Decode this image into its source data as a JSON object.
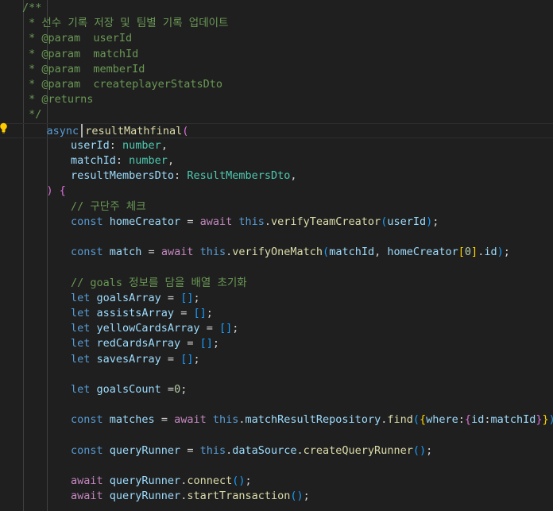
{
  "editor": {
    "lightbulb_icon": "lightbulb-icon",
    "cursor_line": 8,
    "lines": [
      {
        "indent": 0,
        "tokens": [
          {
            "t": "/**",
            "c": "comment"
          }
        ]
      },
      {
        "indent": 0,
        "tokens": [
          {
            "t": " * 선수 기록 저장 및 팀별 기록 업데이트",
            "c": "comment"
          }
        ]
      },
      {
        "indent": 0,
        "tokens": [
          {
            "t": " * @param  userId",
            "c": "comment"
          }
        ]
      },
      {
        "indent": 0,
        "tokens": [
          {
            "t": " * @param  matchId",
            "c": "comment"
          }
        ]
      },
      {
        "indent": 0,
        "tokens": [
          {
            "t": " * @param  memberId",
            "c": "comment"
          }
        ]
      },
      {
        "indent": 0,
        "tokens": [
          {
            "t": " * @param  createplayerStatsDto",
            "c": "comment"
          }
        ]
      },
      {
        "indent": 0,
        "tokens": [
          {
            "t": " * @returns",
            "c": "comment"
          }
        ]
      },
      {
        "indent": 0,
        "tokens": [
          {
            "t": " */",
            "c": "comment"
          }
        ]
      },
      {
        "indent": 1,
        "tokens": [
          {
            "t": "async ",
            "c": "keyword"
          },
          {
            "t": "resultMathfinal",
            "c": "func"
          },
          {
            "t": "(",
            "c": "bracket2"
          }
        ]
      },
      {
        "indent": 2,
        "tokens": [
          {
            "t": "userId",
            "c": "var"
          },
          {
            "t": ": ",
            "c": "plain"
          },
          {
            "t": "number",
            "c": "type"
          },
          {
            "t": ",",
            "c": "plain"
          }
        ]
      },
      {
        "indent": 2,
        "tokens": [
          {
            "t": "matchId",
            "c": "var"
          },
          {
            "t": ": ",
            "c": "plain"
          },
          {
            "t": "number",
            "c": "type"
          },
          {
            "t": ",",
            "c": "plain"
          }
        ]
      },
      {
        "indent": 2,
        "tokens": [
          {
            "t": "resultMembersDto",
            "c": "var"
          },
          {
            "t": ": ",
            "c": "plain"
          },
          {
            "t": "ResultMembersDto",
            "c": "type"
          },
          {
            "t": ",",
            "c": "plain"
          }
        ]
      },
      {
        "indent": 1,
        "tokens": [
          {
            "t": ")",
            "c": "bracket2"
          },
          {
            "t": " ",
            "c": "plain"
          },
          {
            "t": "{",
            "c": "bracket2"
          }
        ]
      },
      {
        "indent": 2,
        "tokens": [
          {
            "t": "// 구단주 체크",
            "c": "comment"
          }
        ]
      },
      {
        "indent": 2,
        "tokens": [
          {
            "t": "const ",
            "c": "keyword"
          },
          {
            "t": "homeCreator",
            "c": "var"
          },
          {
            "t": " = ",
            "c": "plain"
          },
          {
            "t": "await ",
            "c": "keyword-flow"
          },
          {
            "t": "this",
            "c": "keyword"
          },
          {
            "t": ".",
            "c": "plain"
          },
          {
            "t": "verifyTeamCreator",
            "c": "func"
          },
          {
            "t": "(",
            "c": "bracket3"
          },
          {
            "t": "userId",
            "c": "var"
          },
          {
            "t": ")",
            "c": "bracket3"
          },
          {
            "t": ";",
            "c": "plain"
          }
        ]
      },
      {
        "indent": 0,
        "tokens": []
      },
      {
        "indent": 2,
        "tokens": [
          {
            "t": "const ",
            "c": "keyword"
          },
          {
            "t": "match",
            "c": "var"
          },
          {
            "t": " = ",
            "c": "plain"
          },
          {
            "t": "await ",
            "c": "keyword-flow"
          },
          {
            "t": "this",
            "c": "keyword"
          },
          {
            "t": ".",
            "c": "plain"
          },
          {
            "t": "verifyOneMatch",
            "c": "func"
          },
          {
            "t": "(",
            "c": "bracket3"
          },
          {
            "t": "matchId",
            "c": "var"
          },
          {
            "t": ", ",
            "c": "plain"
          },
          {
            "t": "homeCreator",
            "c": "var"
          },
          {
            "t": "[",
            "c": "bracket1"
          },
          {
            "t": "0",
            "c": "number"
          },
          {
            "t": "]",
            "c": "bracket1"
          },
          {
            "t": ".",
            "c": "plain"
          },
          {
            "t": "id",
            "c": "var"
          },
          {
            "t": ")",
            "c": "bracket3"
          },
          {
            "t": ";",
            "c": "plain"
          }
        ]
      },
      {
        "indent": 0,
        "tokens": []
      },
      {
        "indent": 2,
        "tokens": [
          {
            "t": "// goals 정보를 담을 배열 초기화",
            "c": "comment"
          }
        ]
      },
      {
        "indent": 2,
        "tokens": [
          {
            "t": "let ",
            "c": "keyword"
          },
          {
            "t": "goalsArray",
            "c": "var"
          },
          {
            "t": " = ",
            "c": "plain"
          },
          {
            "t": "[",
            "c": "bracket3"
          },
          {
            "t": "]",
            "c": "bracket3"
          },
          {
            "t": ";",
            "c": "plain"
          }
        ]
      },
      {
        "indent": 2,
        "tokens": [
          {
            "t": "let ",
            "c": "keyword"
          },
          {
            "t": "assistsArray",
            "c": "var"
          },
          {
            "t": " = ",
            "c": "plain"
          },
          {
            "t": "[",
            "c": "bracket3"
          },
          {
            "t": "]",
            "c": "bracket3"
          },
          {
            "t": ";",
            "c": "plain"
          }
        ]
      },
      {
        "indent": 2,
        "tokens": [
          {
            "t": "let ",
            "c": "keyword"
          },
          {
            "t": "yellowCardsArray",
            "c": "var"
          },
          {
            "t": " = ",
            "c": "plain"
          },
          {
            "t": "[",
            "c": "bracket3"
          },
          {
            "t": "]",
            "c": "bracket3"
          },
          {
            "t": ";",
            "c": "plain"
          }
        ]
      },
      {
        "indent": 2,
        "tokens": [
          {
            "t": "let ",
            "c": "keyword"
          },
          {
            "t": "redCardsArray",
            "c": "var"
          },
          {
            "t": " = ",
            "c": "plain"
          },
          {
            "t": "[",
            "c": "bracket3"
          },
          {
            "t": "]",
            "c": "bracket3"
          },
          {
            "t": ";",
            "c": "plain"
          }
        ]
      },
      {
        "indent": 2,
        "tokens": [
          {
            "t": "let ",
            "c": "keyword"
          },
          {
            "t": "savesArray",
            "c": "var"
          },
          {
            "t": " = ",
            "c": "plain"
          },
          {
            "t": "[",
            "c": "bracket3"
          },
          {
            "t": "]",
            "c": "bracket3"
          },
          {
            "t": ";",
            "c": "plain"
          }
        ]
      },
      {
        "indent": 0,
        "tokens": []
      },
      {
        "indent": 2,
        "tokens": [
          {
            "t": "let ",
            "c": "keyword"
          },
          {
            "t": "goalsCount",
            "c": "var"
          },
          {
            "t": " =",
            "c": "plain"
          },
          {
            "t": "0",
            "c": "number"
          },
          {
            "t": ";",
            "c": "plain"
          }
        ]
      },
      {
        "indent": 0,
        "tokens": []
      },
      {
        "indent": 2,
        "tokens": [
          {
            "t": "const ",
            "c": "keyword"
          },
          {
            "t": "matches",
            "c": "var"
          },
          {
            "t": " = ",
            "c": "plain"
          },
          {
            "t": "await ",
            "c": "keyword-flow"
          },
          {
            "t": "this",
            "c": "keyword"
          },
          {
            "t": ".",
            "c": "plain"
          },
          {
            "t": "matchResultRepository",
            "c": "var"
          },
          {
            "t": ".",
            "c": "plain"
          },
          {
            "t": "find",
            "c": "func"
          },
          {
            "t": "(",
            "c": "bracket3"
          },
          {
            "t": "{",
            "c": "bracket1"
          },
          {
            "t": "where",
            "c": "var"
          },
          {
            "t": ":",
            "c": "plain"
          },
          {
            "t": "{",
            "c": "bracket2"
          },
          {
            "t": "id",
            "c": "var"
          },
          {
            "t": ":",
            "c": "plain"
          },
          {
            "t": "matchId",
            "c": "var"
          },
          {
            "t": "}",
            "c": "bracket2"
          },
          {
            "t": "}",
            "c": "bracket1"
          },
          {
            "t": ")",
            "c": "bracket3"
          },
          {
            "t": ";",
            "c": "plain"
          }
        ]
      },
      {
        "indent": 0,
        "tokens": []
      },
      {
        "indent": 2,
        "tokens": [
          {
            "t": "const ",
            "c": "keyword"
          },
          {
            "t": "queryRunner",
            "c": "var"
          },
          {
            "t": " = ",
            "c": "plain"
          },
          {
            "t": "this",
            "c": "keyword"
          },
          {
            "t": ".",
            "c": "plain"
          },
          {
            "t": "dataSource",
            "c": "var"
          },
          {
            "t": ".",
            "c": "plain"
          },
          {
            "t": "createQueryRunner",
            "c": "func"
          },
          {
            "t": "(",
            "c": "bracket3"
          },
          {
            "t": ")",
            "c": "bracket3"
          },
          {
            "t": ";",
            "c": "plain"
          }
        ]
      },
      {
        "indent": 0,
        "tokens": []
      },
      {
        "indent": 2,
        "tokens": [
          {
            "t": "await ",
            "c": "keyword-flow"
          },
          {
            "t": "queryRunner",
            "c": "var"
          },
          {
            "t": ".",
            "c": "plain"
          },
          {
            "t": "connect",
            "c": "func"
          },
          {
            "t": "(",
            "c": "bracket3"
          },
          {
            "t": ")",
            "c": "bracket3"
          },
          {
            "t": ";",
            "c": "plain"
          }
        ]
      },
      {
        "indent": 2,
        "tokens": [
          {
            "t": "await ",
            "c": "keyword-flow"
          },
          {
            "t": "queryRunner",
            "c": "var"
          },
          {
            "t": ".",
            "c": "plain"
          },
          {
            "t": "startTransaction",
            "c": "func"
          },
          {
            "t": "(",
            "c": "bracket3"
          },
          {
            "t": ")",
            "c": "bracket3"
          },
          {
            "t": ";",
            "c": "plain"
          }
        ]
      },
      {
        "indent": 0,
        "tokens": []
      }
    ]
  }
}
